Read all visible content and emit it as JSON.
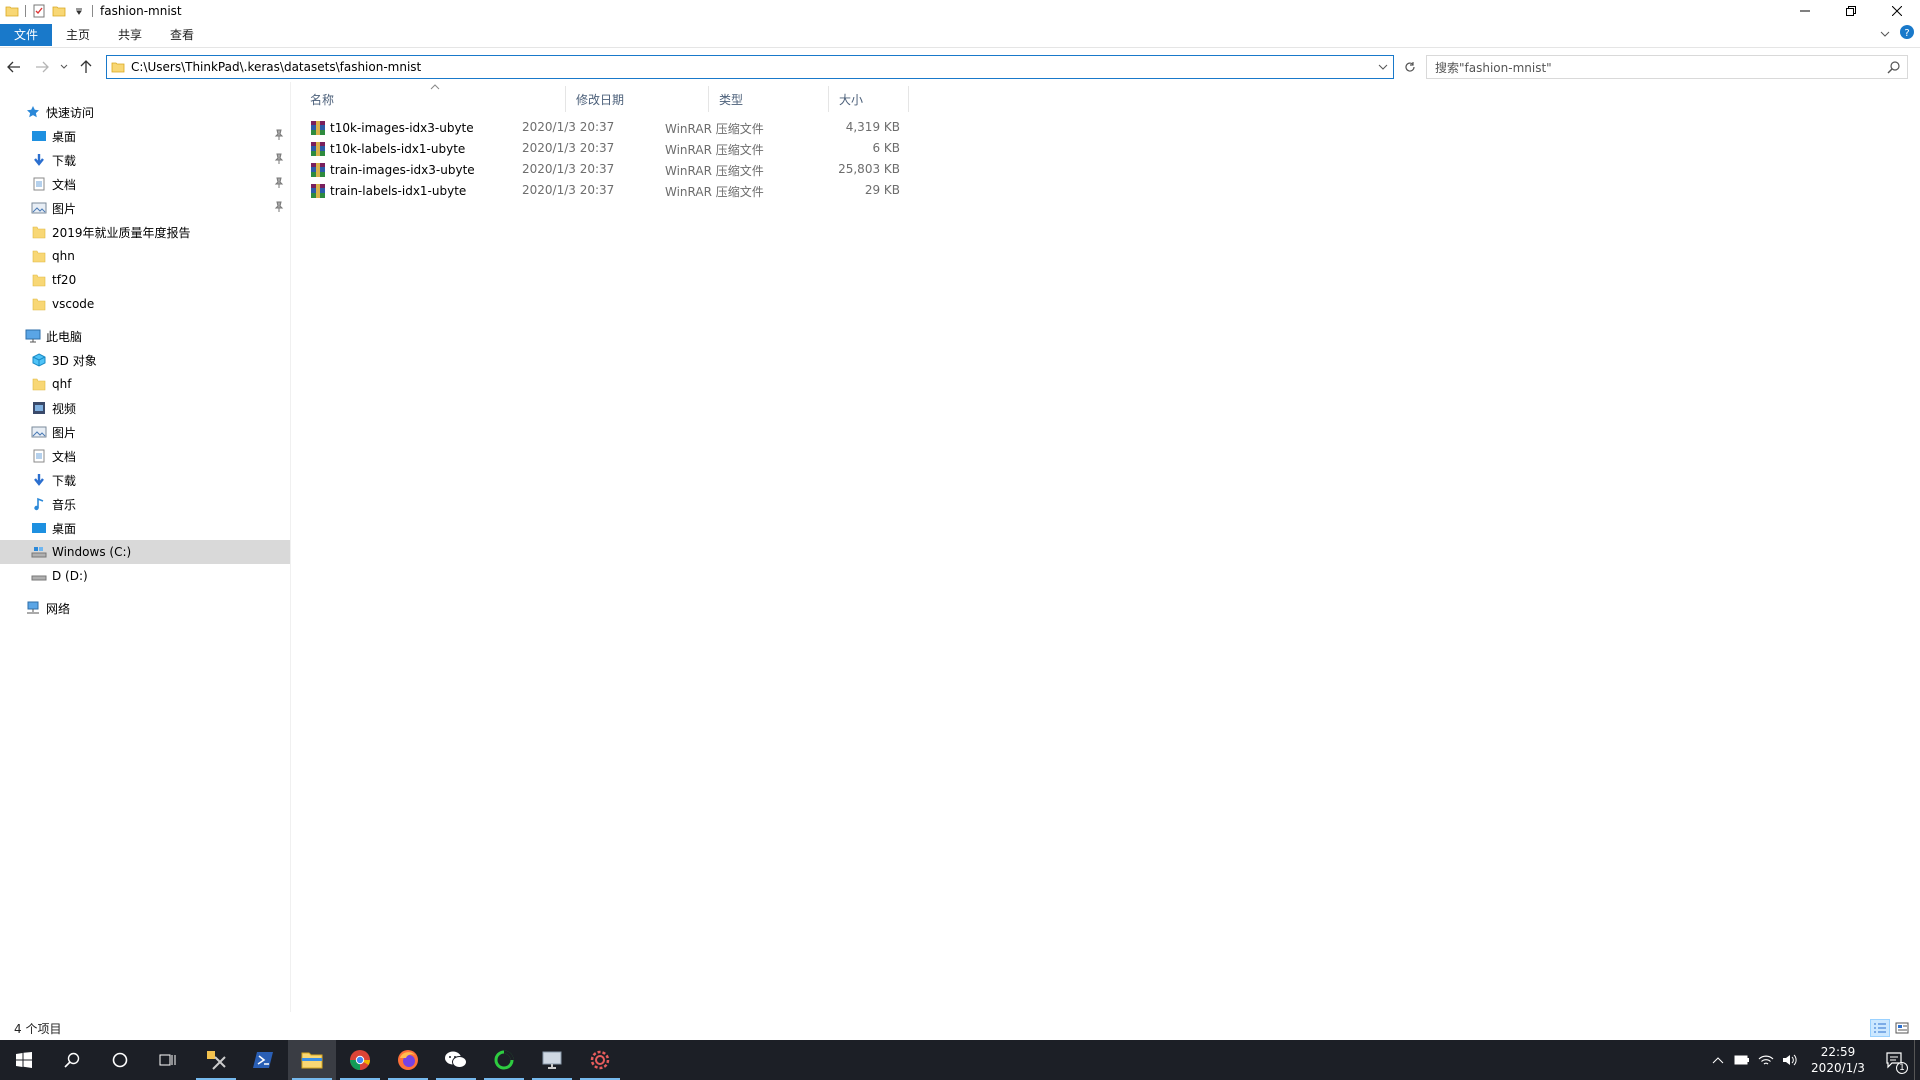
{
  "window": {
    "title": "fashion-mnist"
  },
  "ribbon": {
    "tabs": [
      "文件",
      "主页",
      "共享",
      "查看"
    ]
  },
  "address": {
    "path": "C:\\Users\\ThinkPad\\.keras\\datasets\\fashion-mnist"
  },
  "search": {
    "placeholder": "搜索\"fashion-mnist\""
  },
  "nav": {
    "quick_access": "快速访问",
    "quick_items": [
      {
        "label": "桌面",
        "icon": "desktop-icon",
        "pinned": true
      },
      {
        "label": "下载",
        "icon": "download-icon",
        "pinned": true
      },
      {
        "label": "文档",
        "icon": "document-icon",
        "pinned": true
      },
      {
        "label": "图片",
        "icon": "picture-icon",
        "pinned": true
      },
      {
        "label": "2019年就业质量年度报告",
        "icon": "folder-icon",
        "pinned": false
      },
      {
        "label": "qhn",
        "icon": "folder-icon",
        "pinned": false
      },
      {
        "label": "tf20",
        "icon": "folder-icon",
        "pinned": false
      },
      {
        "label": "vscode",
        "icon": "folder-icon",
        "pinned": false
      }
    ],
    "this_pc": "此电脑",
    "pc_items": [
      {
        "label": "3D 对象",
        "icon": "3d-objects-icon"
      },
      {
        "label": "qhf",
        "icon": "folder-icon"
      },
      {
        "label": "视频",
        "icon": "video-icon"
      },
      {
        "label": "图片",
        "icon": "picture-icon"
      },
      {
        "label": "文档",
        "icon": "document-icon"
      },
      {
        "label": "下载",
        "icon": "download-icon"
      },
      {
        "label": "音乐",
        "icon": "music-icon"
      },
      {
        "label": "桌面",
        "icon": "desktop-icon"
      },
      {
        "label": "Windows (C:)",
        "icon": "drive-c-icon",
        "selected": true
      },
      {
        "label": "D (D:)",
        "icon": "drive-d-icon"
      }
    ],
    "network": "网络"
  },
  "columns": {
    "name": "名称",
    "date": "修改日期",
    "type": "类型",
    "size": "大小"
  },
  "files": [
    {
      "name": "t10k-images-idx3-ubyte",
      "date": "2020/1/3 20:37",
      "type": "WinRAR 压缩文件",
      "size": "4,319 KB"
    },
    {
      "name": "t10k-labels-idx1-ubyte",
      "date": "2020/1/3 20:37",
      "type": "WinRAR 压缩文件",
      "size": "6 KB"
    },
    {
      "name": "train-images-idx3-ubyte",
      "date": "2020/1/3 20:37",
      "type": "WinRAR 压缩文件",
      "size": "25,803 KB"
    },
    {
      "name": "train-labels-idx1-ubyte",
      "date": "2020/1/3 20:37",
      "type": "WinRAR 压缩文件",
      "size": "29 KB"
    }
  ],
  "status": {
    "count": "4 个项目"
  },
  "taskbar": {
    "time": "22:59",
    "date": "2020/1/3",
    "notification_count": "1"
  },
  "colors": {
    "accent": "#1979ca",
    "taskbar": "#1c1f26",
    "selection": "#d9d9d9",
    "header_text": "#4c607a"
  }
}
